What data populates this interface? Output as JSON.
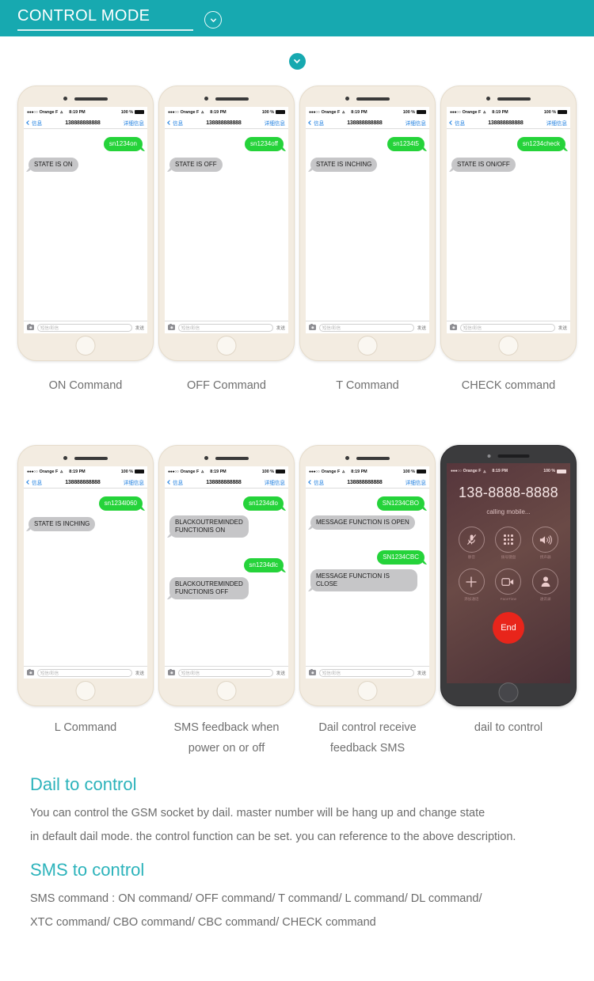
{
  "header": {
    "title": "CONTROL MODE",
    "chevron_icon": "chevron-down-icon",
    "bg_color": "#17a9b0"
  },
  "badge": {
    "icon": "chevron-down-circle-icon",
    "color": "#17a9b0"
  },
  "phone_common": {
    "status": {
      "dots": "●●●○○",
      "carrier": "Orange F",
      "wifi_icon": "wifi-icon",
      "time": "8:19 PM",
      "battery_pct": "100 %",
      "battery_icon": "battery-full-icon"
    },
    "navbar": {
      "back_label": "信息",
      "number": "138888888888",
      "detail_label": "详细信息"
    },
    "compose": {
      "camera_icon": "camera-icon",
      "placeholder": "短信/彩信",
      "send_label": "发送"
    },
    "home_button_icon": "home-button-icon"
  },
  "row1": [
    {
      "caption": "ON Command",
      "messages": [
        {
          "dir": "out",
          "text": "sn1234on"
        },
        {
          "dir": "in",
          "text": "STATE IS ON"
        }
      ]
    },
    {
      "caption": "OFF Command",
      "messages": [
        {
          "dir": "out",
          "text": "sn1234off"
        },
        {
          "dir": "in",
          "text": "STATE IS OFF"
        }
      ]
    },
    {
      "caption": "T Command",
      "messages": [
        {
          "dir": "out",
          "text": "sn1234t5"
        },
        {
          "dir": "in",
          "text": "STATE IS INCHING"
        }
      ]
    },
    {
      "caption": "CHECK command",
      "messages": [
        {
          "dir": "out",
          "text": "sn1234check"
        },
        {
          "dir": "in",
          "text": "STATE IS ON/OFF"
        }
      ]
    }
  ],
  "row2": [
    {
      "caption": "L Command",
      "messages": [
        {
          "dir": "out",
          "text": "sn1234l060"
        },
        {
          "dir": "in",
          "text": "STATE IS INCHING"
        }
      ]
    },
    {
      "caption": "SMS feedback when power on or off",
      "messages": [
        {
          "dir": "out",
          "text": "sn1234dlo"
        },
        {
          "dir": "in",
          "text": "BLACKOUTREMINDED\nFUNCTIONIS ON"
        },
        {
          "dir": "gap",
          "text": ""
        },
        {
          "dir": "out",
          "text": "sn1234dlc"
        },
        {
          "dir": "in",
          "text": "BLACKOUTREMINDED\nFUNCTIONIS OFF"
        }
      ]
    },
    {
      "caption": "Dail control receive feedback SMS",
      "messages": [
        {
          "dir": "out",
          "text": "SN1234CBO"
        },
        {
          "dir": "in",
          "text": "MESSAGE FUNCTION IS OPEN"
        },
        {
          "dir": "gap",
          "text": ""
        },
        {
          "dir": "out",
          "text": "SN1234CBC"
        },
        {
          "dir": "in",
          "text": "MESSAGE FUNCTION IS CLOSE"
        }
      ]
    }
  ],
  "call_phone": {
    "caption": "dail to control",
    "status": {
      "dots": "●●●○○",
      "carrier": "Orange F",
      "time": "8:19 PM",
      "battery_pct": "100 %"
    },
    "number": "138-8888-8888",
    "subtitle": "calling mobile...",
    "buttons": [
      {
        "icon": "mute-microphone-icon",
        "label": "静音"
      },
      {
        "icon": "keypad-icon",
        "label": "拨号键盘"
      },
      {
        "icon": "speaker-icon",
        "label": "扬声器"
      },
      {
        "icon": "add-call-icon",
        "label": "添加通话"
      },
      {
        "icon": "facetime-icon",
        "label": "FaceTime"
      },
      {
        "icon": "contacts-icon",
        "label": "通讯录"
      }
    ],
    "end_label": "End",
    "end_color": "#e8251b"
  },
  "copy": {
    "dail_heading": "Dail to control",
    "dail_line1": "You can control the GSM socket  by dail. master  number will be hang up and change  state",
    "dail_line2": "in default dail mode. the control function can be set. you can reference to the above description.",
    "sms_heading": "SMS to control",
    "sms_line1": "SMS  command :   ON command/ OFF command/ T command/ L command/ DL command/",
    "sms_line2": " XTC command/ CBO command/ CBC command/ CHECK command",
    "heading_color": "#2cb3bb"
  }
}
